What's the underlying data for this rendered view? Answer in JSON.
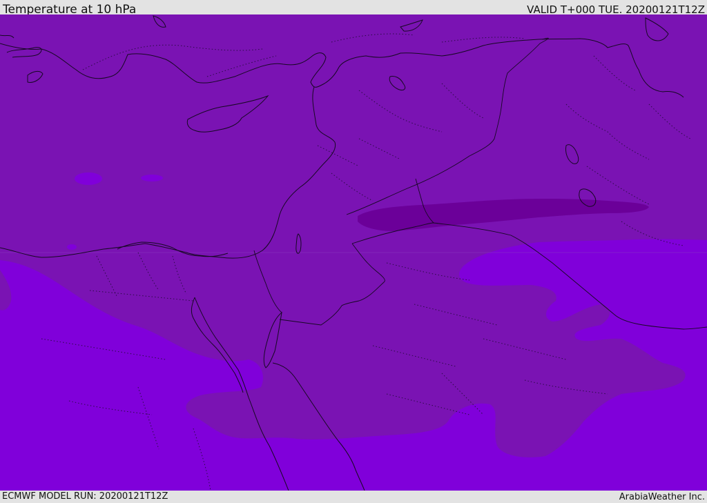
{
  "header": {
    "title": "Temperature at 10 hPa",
    "valid": "VALID T+000 TUE. 20200121T12Z"
  },
  "footer": {
    "model_run": "ECMWF MODEL RUN: 20200121T12Z",
    "credit": "ArabiaWeather Inc."
  },
  "map": {
    "field_colors": {
      "warmest_band": "#6b0099",
      "mid_band": "#7a13b3",
      "cool_band": "#8000da"
    },
    "coastline_color": "#160822"
  }
}
